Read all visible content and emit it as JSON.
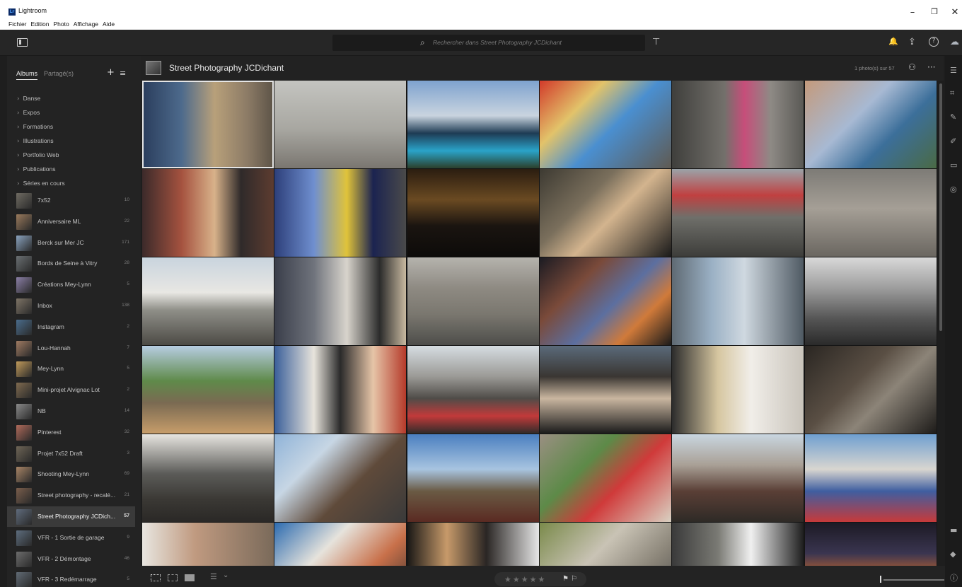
{
  "window": {
    "app_name": "Lightroom",
    "logo_text": "Lr",
    "menu": [
      "Fichier",
      "Edition",
      "Photo",
      "Affichage",
      "Aide"
    ],
    "controls": {
      "minimize": "–",
      "restore": "❐",
      "close": "✕"
    }
  },
  "toolbar": {
    "search_placeholder": "Rechercher dans Street Photography JCDichant",
    "icons": {
      "search": "⌕",
      "filter": "⊤",
      "bell": "🔔",
      "share": "⇪",
      "help": "?",
      "cloud": "☁"
    }
  },
  "left_panel": {
    "tabs": [
      {
        "label": "Albums",
        "active": true
      },
      {
        "label": "Partagé(s)",
        "active": false
      }
    ],
    "header_icons": {
      "add": "+",
      "sort": "≡"
    },
    "chevron": "›",
    "folders": [
      "Danse",
      "Expos",
      "Formations",
      "Illustrations",
      "Portfolio Web",
      "Publications",
      "Séries en cours"
    ],
    "albums": [
      {
        "name": "7x52",
        "count": "10",
        "color": "#6f6b62"
      },
      {
        "name": "Anniversaire ML",
        "count": "22",
        "color": "#9a7a5c"
      },
      {
        "name": "Berck sur Mer JC",
        "count": "171",
        "color": "#8aa3bf"
      },
      {
        "name": "Bords de Seine à Vitry",
        "count": "28",
        "color": "#6a6f72"
      },
      {
        "name": "Créations Mey-Lynn",
        "count": "5",
        "color": "#8b7fa6"
      },
      {
        "name": "Inbox",
        "count": "138",
        "color": "#7e7466"
      },
      {
        "name": "Instagram",
        "count": "2",
        "color": "#4a6c8c"
      },
      {
        "name": "Lou-Hannah",
        "count": "7",
        "color": "#a07b62"
      },
      {
        "name": "Mey-Lynn",
        "count": "5",
        "color": "#c09a5a"
      },
      {
        "name": "Mini-projet Alvignac Lot",
        "count": "2",
        "color": "#7f6a4f"
      },
      {
        "name": "NB",
        "count": "14",
        "color": "#8a8a8a"
      },
      {
        "name": "Pinterest",
        "count": "32",
        "color": "#b06a5a"
      },
      {
        "name": "Projet 7x52 Draft",
        "count": "3",
        "color": "#6e6556"
      },
      {
        "name": "Shooting Mey-Lynn",
        "count": "69",
        "color": "#a88566"
      },
      {
        "name": "Street photography - recalé...",
        "count": "21",
        "color": "#7a5e4c"
      },
      {
        "name": "Street Photography JCDich...",
        "count": "57",
        "color": "#5f6b7c",
        "selected": true
      },
      {
        "name": "VFR - 1 Sortie de garage",
        "count": "9",
        "color": "#5d6d7e"
      },
      {
        "name": "VFR - 2 Démontage",
        "count": "46",
        "color": "#6c6c6c"
      },
      {
        "name": "VFR - 3 Redémarrage",
        "count": "5",
        "color": "#606a74"
      }
    ]
  },
  "main": {
    "album_title": "Street Photography JCDichant",
    "photo_count": "1 photo(s) sur 57",
    "header_icons": {
      "people": "⚇",
      "more": "···"
    }
  },
  "photos": [
    {
      "bg": "linear-gradient(90deg,#2a3d5c 0%,#4d6a8c 30%,#b8a07a 55%,#8c7b66 80%,#5c5347 100%)",
      "selected": true
    },
    {
      "bg": "linear-gradient(180deg,#c4c4c0 0%,#a8a7a1 55%,#7a7670 100%)"
    },
    {
      "bg": "linear-gradient(180deg,#7ea2cf 0%,#c9d4df 40%,#1e3b54 60%,#2aa3c9 80%,#2b3f2a 100%)"
    },
    {
      "bg": "linear-gradient(135deg,#d23a2a 0%,#e2c36a 30%,#4a8fd0 55%,#5f5a52 100%)"
    },
    {
      "bg": "linear-gradient(90deg,#3f3f3c 0%,#73706b 40%,#c64e7a 55%,#8e8a85 75%,#5a5955 100%)"
    },
    {
      "bg": "linear-gradient(135deg,#c49a7c 0%,#a7b9d3 40%,#3c6f9a 65%,#4a6a45 100%)"
    },
    {
      "bg": "linear-gradient(90deg,#3b2a2a 0%,#a5523f 30%,#d8b28a 55%,#2f2a2a 75%,#5d3c30 100%)"
    },
    {
      "bg": "linear-gradient(90deg,#2d3f7a 0%,#6f8fcf 30%,#e0c33a 55%,#1b2350 75%,#4a4a4a 100%)"
    },
    {
      "bg": "linear-gradient(180deg,#2b1d10 0%,#6a4a22 35%,#1a1410 65%,#0d0b09 100%)"
    },
    {
      "bg": "linear-gradient(135deg,#3d3a32 0%,#7a6f5c 35%,#d3b48e 55%,#1a1a1a 100%)"
    },
    {
      "bg": "linear-gradient(180deg,#9aa3a8 0%,#c04040 30%,#6f6f6a 55%,#3d3d3a 100%)"
    },
    {
      "bg": "linear-gradient(180deg,#7d7b76 0%,#a59f96 45%,#6a6660 100%)"
    },
    {
      "bg": "linear-gradient(180deg,#c9d4de 0%,#e8e7e3 40%,#8f8f88 60%,#4c4a45 100%)"
    },
    {
      "bg": "linear-gradient(90deg,#3a3e4a 0%,#6f737c 30%,#d8d4cc 55%,#2b2b2b 80%,#c8b9a0 100%)"
    },
    {
      "bg": "linear-gradient(180deg,#b5b3ad 0%,#8e8a82 35%,#7a776f 65%,#4d4d4a 100%)"
    },
    {
      "bg": "linear-gradient(135deg,#1b1b22 0%,#7a4a3a 30%,#5c6fa0 55%,#d07a3a 75%,#1a1a1a 100%)"
    },
    {
      "bg": "linear-gradient(90deg,#5f6a73 0%,#9ab0c4 30%,#cfd8e0 55%,#4f5a63 100%)"
    },
    {
      "bg": "linear-gradient(180deg,#d9d9d9 0%,#9d9d9d 35%,#555 70%,#2a2a2a 100%)"
    },
    {
      "bg": "linear-gradient(180deg,#b7cde2 0%,#5f8a4a 40%,#7a6a52 65%,#c79d6a 100%)"
    },
    {
      "bg": "linear-gradient(90deg,#3a5f9a 0%,#e8e4dc 30%,#2a2a2a 50%,#e6c5a8 75%,#b53a2a 100%)"
    },
    {
      "bg": "linear-gradient(180deg,#d6dde2 0%,#9b9a96 35%,#4f4c48 60%,#c23a3a 80%,#2f2c2a 100%)"
    },
    {
      "bg": "linear-gradient(180deg,#5a6a7a 0%,#3a3632 35%,#c9b6a0 60%,#1a1a1a 100%)"
    },
    {
      "bg": "linear-gradient(90deg,#2c2c2c 0%,#d6c6a0 35%,#f1eee9 60%,#c9c4bb 100%)"
    },
    {
      "bg": "linear-gradient(135deg,#2a2622 0%,#5a4f44 40%,#8c8478 60%,#1d1b19 100%)"
    },
    {
      "bg": "linear-gradient(180deg,#e7e5e0 0%,#5b5b58 45%,#3a3834 75%,#2a2826 100%)"
    },
    {
      "bg": "linear-gradient(135deg,#8fb3d8 0%,#c7d6e4 30%,#5f4a3a 60%,#3a3a3a 100%)"
    },
    {
      "bg": "linear-gradient(180deg,#4a7fc0 0%,#a8c4e0 40%,#6a5a44 65%,#5a2a22 100%)"
    },
    {
      "bg": "linear-gradient(135deg,#9a8f82 0%,#5d8a48 35%,#d03a3a 60%,#d9d1c2 100%)"
    },
    {
      "bg": "linear-gradient(180deg,#c9d6e0 0%,#a9a096 35%,#5a3f36 65%,#2e2a26 100%)"
    },
    {
      "bg": "linear-gradient(180deg,#6f9fd0 0%,#d9d6d0 40%,#3f5ea0 65%,#c73a3a 100%)"
    },
    {
      "bg": "linear-gradient(90deg,#e8e6e0 0%,#c09a80 40%,#7a6a5a 100%)"
    },
    {
      "bg": "linear-gradient(135deg,#2c6bb0 0%,#e6e3dc 35%,#c8704a 65%,#2a2a2a 100%)"
    },
    {
      "bg": "linear-gradient(90deg,#1a1816 0%,#c79a6a 30%,#2a2624 60%,#e6e6e6 100%)"
    },
    {
      "bg": "linear-gradient(135deg,#7a8a4a 0%,#c9c3b5 40%,#8a8478 70%,#4a4a4a 100%)"
    },
    {
      "bg": "linear-gradient(90deg,#3a3a3a 0%,#7a7a74 35%,#f0f0f0 60%,#1e1e1e 100%)"
    },
    {
      "bg": "linear-gradient(180deg,#1c1a24 0%,#3a3550 35%,#d26a2a 65%,#2a2626 100%)"
    }
  ],
  "bottom_bar": {
    "stars": "★★★★★",
    "flags": "⚑ ⚐",
    "sort_icon": "☰",
    "sort_chevron": "⌄"
  }
}
